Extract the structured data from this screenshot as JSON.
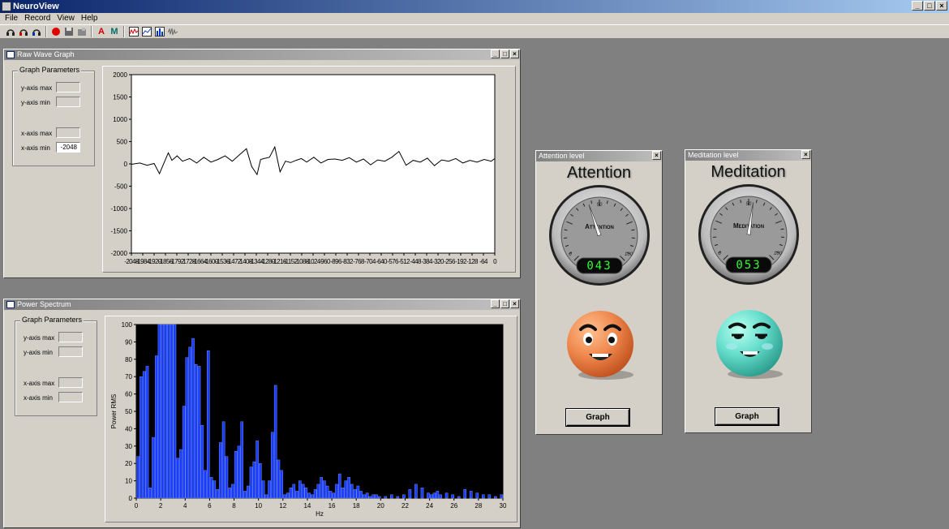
{
  "app": {
    "title": "NeuroView"
  },
  "menu": [
    "File",
    "Record",
    "View",
    "Help"
  ],
  "toolbar": {
    "letter_a": "A",
    "letter_m": "M"
  },
  "raw_wave": {
    "title": "Raw Wave Graph",
    "params_label": "Graph Parameters",
    "y_max_label": "y-axis max",
    "y_min_label": "y-axis min",
    "x_max_label": "x-axis max",
    "x_min_label": "x-axis min",
    "x_min_value": "-2048"
  },
  "power": {
    "title": "Power Spectrum",
    "params_label": "Graph Parameters",
    "y_max_label": "y-axis max",
    "y_min_label": "y-axis min",
    "x_max_label": "x-axis max",
    "x_min_label": "x-axis min"
  },
  "attention": {
    "window_title": "Attention level",
    "heading": "Attention",
    "dial_label": "Attention",
    "scale_mid": "50",
    "scale_min": "0",
    "scale_max": "100",
    "value": 43,
    "display": "043",
    "button": "Graph"
  },
  "meditation": {
    "window_title": "Meditation level",
    "heading": "Meditation",
    "dial_label": "Meditation",
    "scale_mid": "50",
    "scale_min": "0",
    "scale_max": "100",
    "value": 53,
    "display": "053",
    "button": "Graph"
  },
  "chart_data": [
    {
      "type": "line",
      "title": "Raw Wave Graph",
      "ylim": [
        -2000,
        2000
      ],
      "yticks": [
        "2000",
        "1500",
        "1000",
        "500",
        "0",
        "-500",
        "-1000",
        "-1500",
        "-2000"
      ],
      "xlim": [
        -2048,
        0
      ],
      "xticks": [
        "-2048",
        "-1984",
        "-1920",
        "-1856",
        "-1792",
        "-1728",
        "-1664",
        "-1600",
        "-1536",
        "-1472",
        "-1408",
        "-1344",
        "-1280",
        "-1216",
        "-1152",
        "-1088",
        "-1024",
        "-960",
        "-896",
        "-832",
        "-768",
        "-704",
        "-640",
        "-576",
        "-512",
        "-448",
        "-384",
        "-320",
        "-256",
        "-192",
        "-128",
        "-64",
        "0"
      ],
      "x": [
        -2048,
        -2000,
        -1960,
        -1920,
        -1890,
        -1860,
        -1840,
        -1820,
        -1790,
        -1760,
        -1720,
        -1680,
        -1640,
        -1600,
        -1560,
        -1520,
        -1480,
        -1440,
        -1400,
        -1370,
        -1340,
        -1320,
        -1300,
        -1270,
        -1240,
        -1210,
        -1180,
        -1150,
        -1120,
        -1090,
        -1060,
        -1020,
        -980,
        -940,
        -900,
        -860,
        -820,
        -780,
        -740,
        -700,
        -660,
        -620,
        -580,
        -540,
        -500,
        -460,
        -420,
        -380,
        -340,
        -300,
        -260,
        -220,
        -180,
        -140,
        -100,
        -60,
        -20,
        0
      ],
      "values": [
        -10,
        20,
        -30,
        10,
        -220,
        60,
        250,
        80,
        180,
        60,
        120,
        20,
        150,
        40,
        100,
        180,
        60,
        200,
        340,
        -60,
        -240,
        100,
        120,
        150,
        380,
        -180,
        60,
        30,
        80,
        120,
        40,
        150,
        20,
        100,
        110,
        80,
        140,
        40,
        110,
        -20,
        90,
        60,
        150,
        280,
        -30,
        80,
        40,
        130,
        -40,
        90,
        60,
        120,
        20,
        80,
        40,
        100,
        60,
        120
      ]
    },
    {
      "type": "bar",
      "title": "Power Spectrum",
      "xlabel": "Hz",
      "ylabel": "Power RMS",
      "ylim": [
        0,
        100
      ],
      "xlim": [
        0,
        30
      ],
      "yticks": [
        "100",
        "90",
        "80",
        "70",
        "60",
        "50",
        "40",
        "30",
        "20",
        "10",
        "0"
      ],
      "xticks": [
        "0",
        "2",
        "4",
        "6",
        "8",
        "10",
        "12",
        "14",
        "16",
        "18",
        "20",
        "22",
        "24",
        "26",
        "28",
        "30"
      ],
      "x": [
        0.25,
        0.5,
        0.75,
        1,
        1.25,
        1.5,
        1.75,
        2,
        2.25,
        2.5,
        2.75,
        3,
        3.25,
        3.5,
        3.75,
        4,
        4.25,
        4.5,
        4.75,
        5,
        5.25,
        5.5,
        5.75,
        6,
        6.25,
        6.5,
        6.75,
        7,
        7.25,
        7.5,
        7.75,
        8,
        8.25,
        8.5,
        8.75,
        9,
        9.25,
        9.5,
        9.75,
        10,
        10.25,
        10.5,
        10.75,
        11,
        11.25,
        11.5,
        11.75,
        12,
        12.25,
        12.5,
        12.75,
        13,
        13.25,
        13.5,
        13.75,
        14,
        14.25,
        14.5,
        14.75,
        15,
        15.25,
        15.5,
        15.75,
        16,
        16.25,
        16.5,
        16.75,
        17,
        17.25,
        17.5,
        17.75,
        18,
        18.25,
        18.5,
        18.75,
        19,
        19.25,
        19.5,
        19.75,
        20,
        20.5,
        21,
        21.5,
        22,
        22.5,
        23,
        23.5,
        24,
        24.25,
        24.5,
        24.75,
        25,
        25.5,
        26,
        26.5,
        27,
        27.5,
        28,
        28.5,
        29,
        29.5,
        30
      ],
      "values": [
        24,
        70,
        73,
        76,
        6,
        35,
        82,
        100,
        100,
        100,
        100,
        100,
        100,
        23,
        28,
        53,
        81,
        87,
        92,
        77,
        76,
        42,
        16,
        85,
        12,
        10,
        5,
        32,
        44,
        24,
        6,
        8,
        27,
        30,
        44,
        4,
        7,
        18,
        21,
        33,
        20,
        10,
        2,
        10,
        38,
        65,
        22,
        16,
        2,
        3,
        6,
        8,
        4,
        10,
        8,
        6,
        3,
        2,
        5,
        8,
        12,
        10,
        7,
        4,
        3,
        8,
        14,
        6,
        10,
        12,
        8,
        5,
        7,
        4,
        2,
        3,
        1,
        2,
        2,
        1,
        1,
        2,
        1,
        2,
        5,
        8,
        6,
        3,
        2,
        3,
        4,
        2,
        3,
        2,
        1,
        5,
        4,
        3,
        2,
        2,
        1,
        2,
        3,
        1
      ]
    }
  ]
}
